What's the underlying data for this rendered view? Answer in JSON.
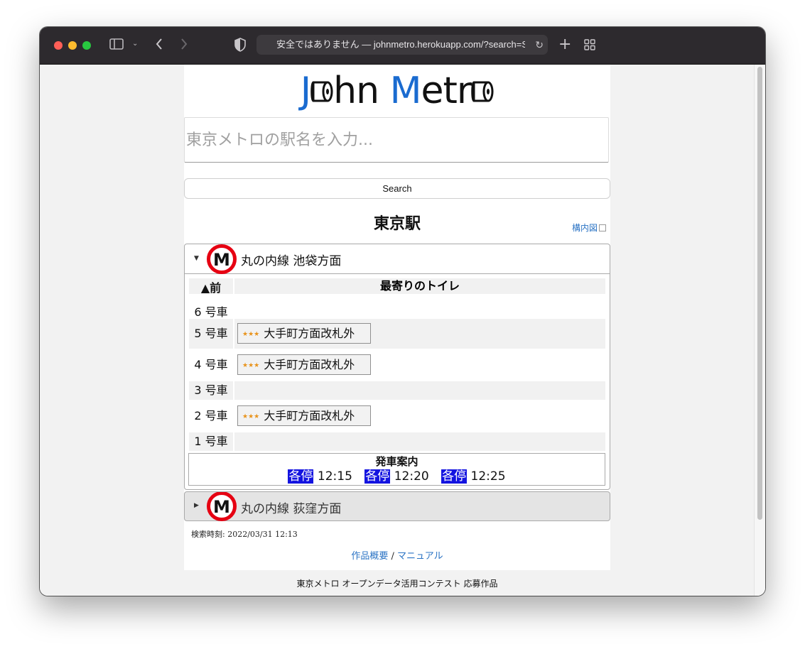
{
  "browser": {
    "url": "安全ではありません — johnmetro.herokuapp.com/?search=S"
  },
  "logo": {
    "part1": "J",
    "part2": "hn ",
    "part3": "M",
    "part4": "etr"
  },
  "search": {
    "placeholder": "東京メトロの駅名を入力...",
    "button_label": "Search"
  },
  "station": {
    "title": "東京駅",
    "map_link": "構内図"
  },
  "panels": [
    {
      "line_name": "丸の内線 池袋方面",
      "header": {
        "front": "▲前",
        "toilet": "最寄りのトイレ"
      },
      "cars": [
        {
          "car": "6 号車",
          "toilet": ""
        },
        {
          "car": "5 号車",
          "toilet": "大手町方面改札外",
          "stars": "★★★"
        },
        {
          "car": "4 号車",
          "toilet": "大手町方面改札外",
          "stars": "★★★"
        },
        {
          "car": "3 号車",
          "toilet": ""
        },
        {
          "car": "2 号車",
          "toilet": "大手町方面改札外",
          "stars": "★★★"
        },
        {
          "car": "1 号車",
          "toilet": ""
        }
      ],
      "departures_title": "発車案内",
      "departures": [
        {
          "type": "各停",
          "time": "12:15"
        },
        {
          "type": "各停",
          "time": "12:20"
        },
        {
          "type": "各停",
          "time": "12:25"
        }
      ]
    },
    {
      "line_name": "丸の内線 荻窪方面"
    }
  ],
  "search_time": "検索時刻: 2022/03/31 12:13",
  "footer": {
    "about": "作品概要",
    "separator": " / ",
    "manual": "マニュアル",
    "contest": "東京メトロ オープンデータ活用コンテスト 応募作品"
  },
  "colors": {
    "logo_blue": "#1a6bd0",
    "metro_red": "#e60012",
    "train_type_bg": "#1414e0",
    "link": "#2a73c4"
  }
}
